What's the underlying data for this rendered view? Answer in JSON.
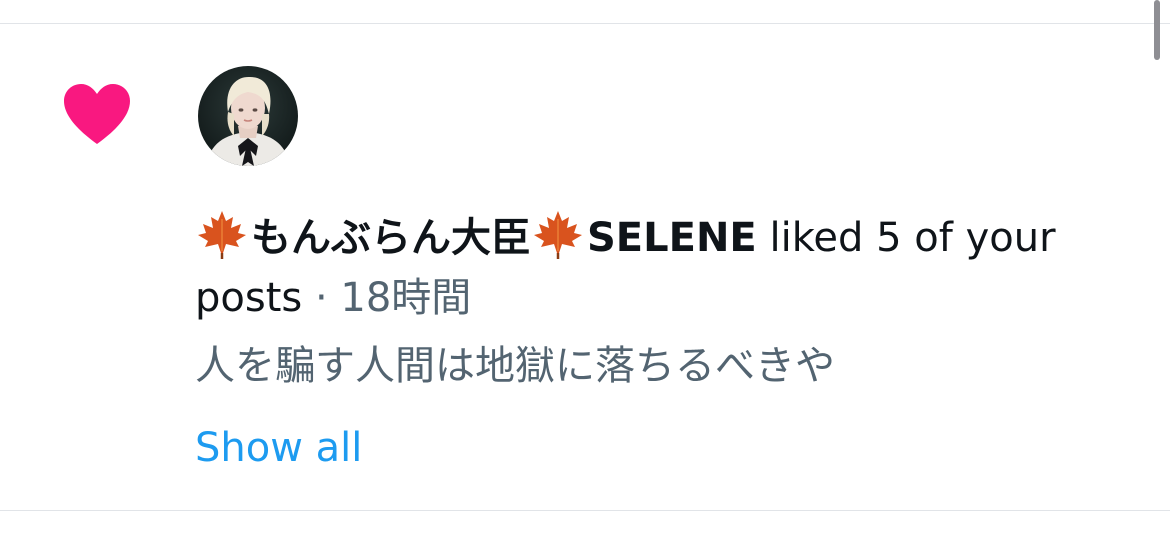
{
  "notification": {
    "actor_name": "もんぶらん大臣",
    "actor_handle_name": "SELENE",
    "action_text": " liked 5 of your posts",
    "separator": " · ",
    "timestamp": "18時間",
    "post_snippet": "人を騙す人間は地獄に落ちるべきや",
    "show_all_label": "Show all"
  },
  "icons": {
    "like": "heart-icon",
    "emoji": "maple-leaf-icon"
  },
  "colors": {
    "like": "#f91880",
    "link": "#1d9bf0",
    "muted": "#536471",
    "text": "#0f1419",
    "divider": "#e1e4e8"
  }
}
